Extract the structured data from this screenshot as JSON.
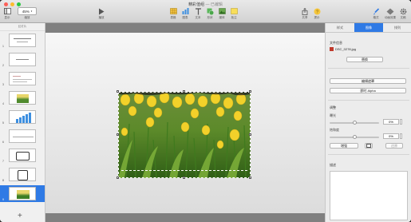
{
  "window": {
    "title": "精彩值组",
    "title_suffix": "— 已编辑"
  },
  "toolbar": {
    "view_label": "显示",
    "zoom_value": "45%",
    "zoom_label": "缩放",
    "play_label": "播放",
    "insert_items": [
      {
        "label": "表格",
        "icon": "table-icon"
      },
      {
        "label": "图表",
        "icon": "chart-icon"
      },
      {
        "label": "文本",
        "icon": "text-icon"
      },
      {
        "label": "形状",
        "icon": "shape-icon"
      },
      {
        "label": "媒体",
        "icon": "media-icon"
      },
      {
        "label": "批注",
        "icon": "comment-icon"
      }
    ],
    "share_label": "共享",
    "tips_label": "提示",
    "format_label": "格式",
    "animate_label": "动画效果",
    "document_label": "文稿"
  },
  "navigator": {
    "header": "幻灯片",
    "slides": [
      {
        "number": "1"
      },
      {
        "number": "2"
      },
      {
        "number": "3"
      },
      {
        "number": "4"
      },
      {
        "number": "5"
      },
      {
        "number": "6"
      },
      {
        "number": "7"
      },
      {
        "number": "8"
      },
      {
        "number": "9"
      }
    ],
    "selected_index": 8,
    "add_label": "+"
  },
  "inspector": {
    "tabs": [
      "样式",
      "图像",
      "排列"
    ],
    "active_tab": 1,
    "file_section_title": "文件信息",
    "file_name": "DSC_0278.jpg",
    "replace_button": "替换",
    "edit_mask_button": "编辑遮罩",
    "instant_alpha_button": "即时 Alpha",
    "adjust_title": "调整",
    "exposure_label": "曝光",
    "exposure_value": "0%",
    "saturation_label": "饱和度",
    "saturation_value": "0%",
    "enhance_button": "增强",
    "reset_button": "还原",
    "description_label": "描述"
  },
  "colors": {
    "accent": "#2f7ae5"
  }
}
